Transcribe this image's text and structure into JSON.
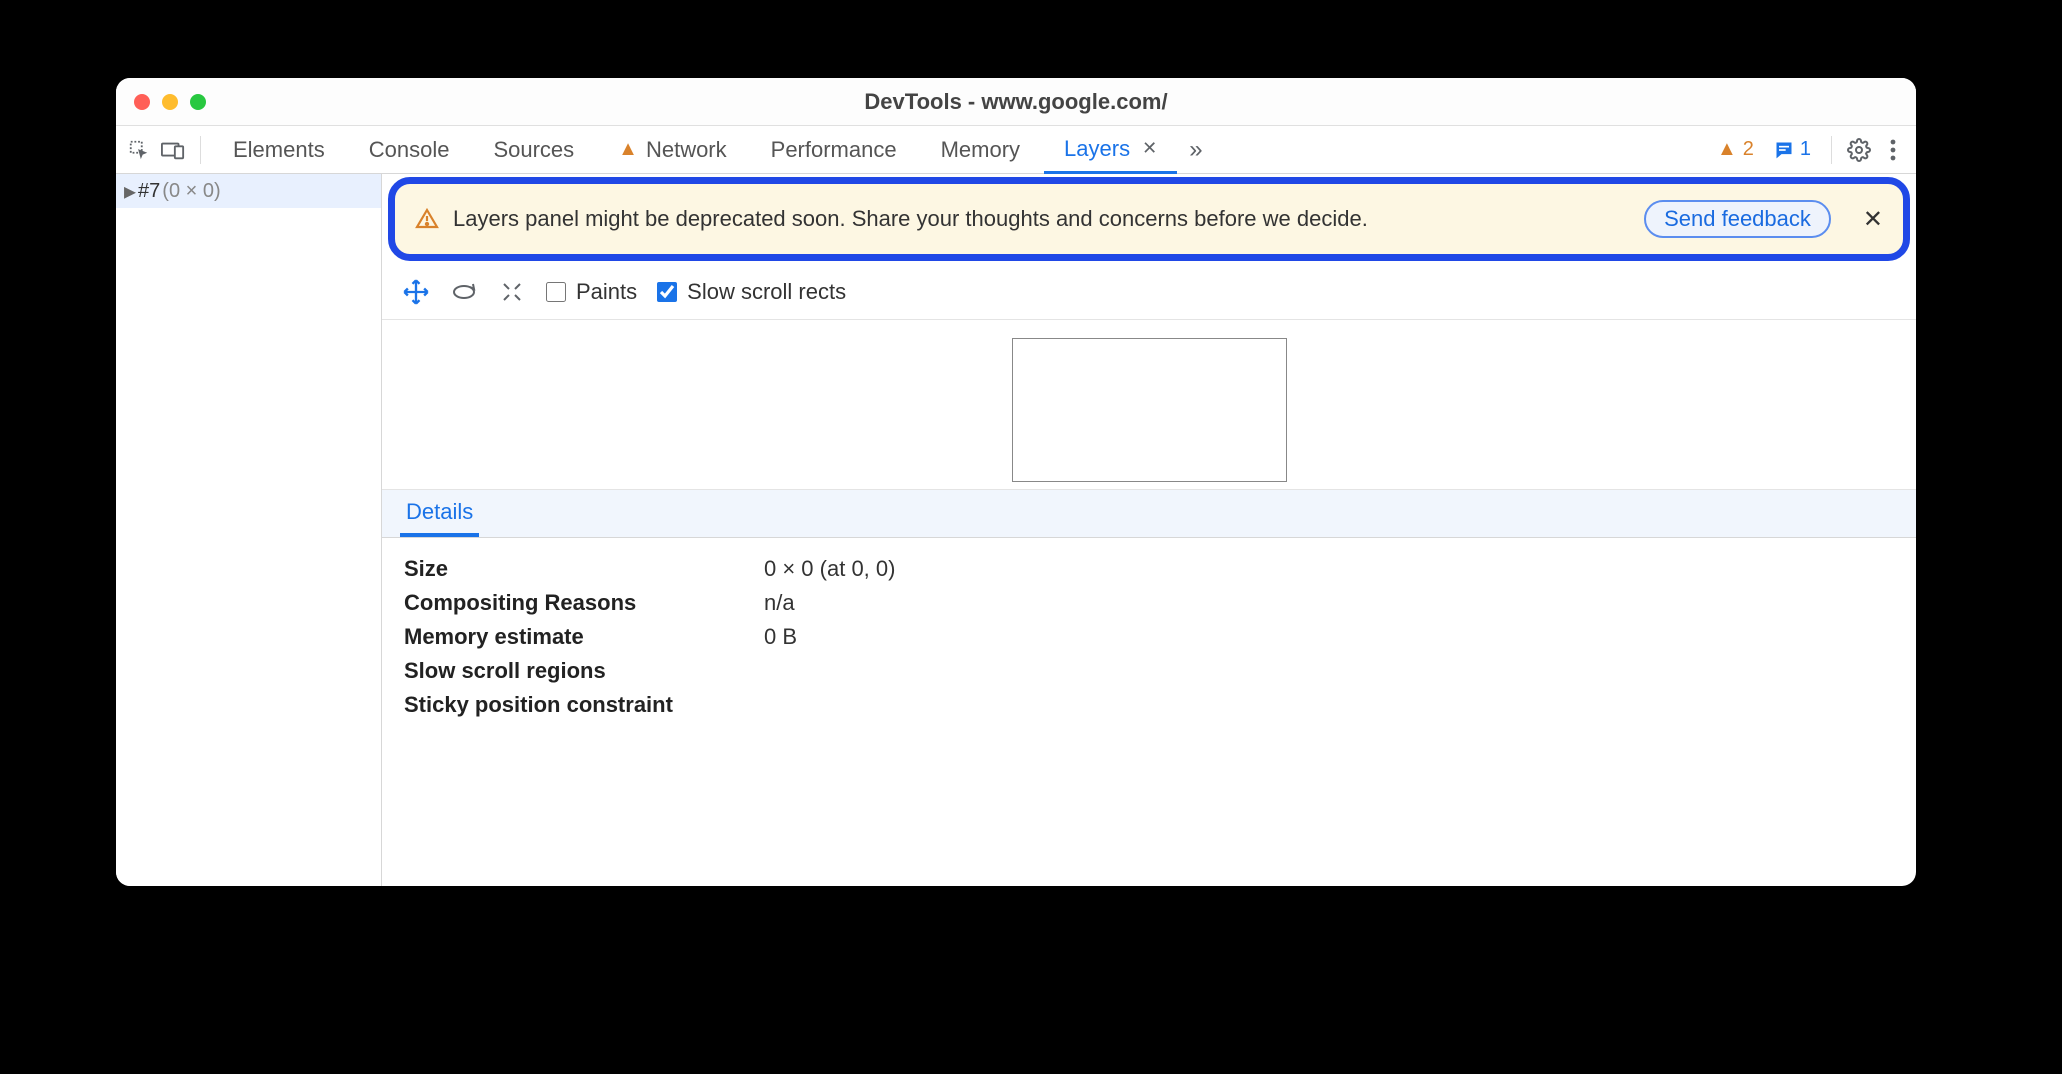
{
  "window": {
    "title": "DevTools - www.google.com/"
  },
  "tabs": {
    "elements": "Elements",
    "console": "Console",
    "sources": "Sources",
    "network": "Network",
    "performance": "Performance",
    "memory": "Memory",
    "layers": "Layers"
  },
  "counters": {
    "warnings": "2",
    "messages": "1"
  },
  "tree": {
    "item0": {
      "id": "#7",
      "dims": "(0 × 0)"
    }
  },
  "banner": {
    "text": "Layers panel might be deprecated soon. Share your thoughts and concerns before we decide.",
    "button": "Send feedback"
  },
  "controls": {
    "paints_label": "Paints",
    "paints_checked": false,
    "slow_scroll_label": "Slow scroll rects",
    "slow_scroll_checked": true
  },
  "details": {
    "tab_label": "Details",
    "rows": {
      "size": {
        "k": "Size",
        "v": "0 × 0 (at 0, 0)"
      },
      "compositing": {
        "k": "Compositing Reasons",
        "v": "n/a"
      },
      "memory": {
        "k": "Memory estimate",
        "v": "0 B"
      },
      "slowscroll": {
        "k": "Slow scroll regions",
        "v": ""
      },
      "sticky": {
        "k": "Sticky position constraint",
        "v": ""
      }
    }
  }
}
